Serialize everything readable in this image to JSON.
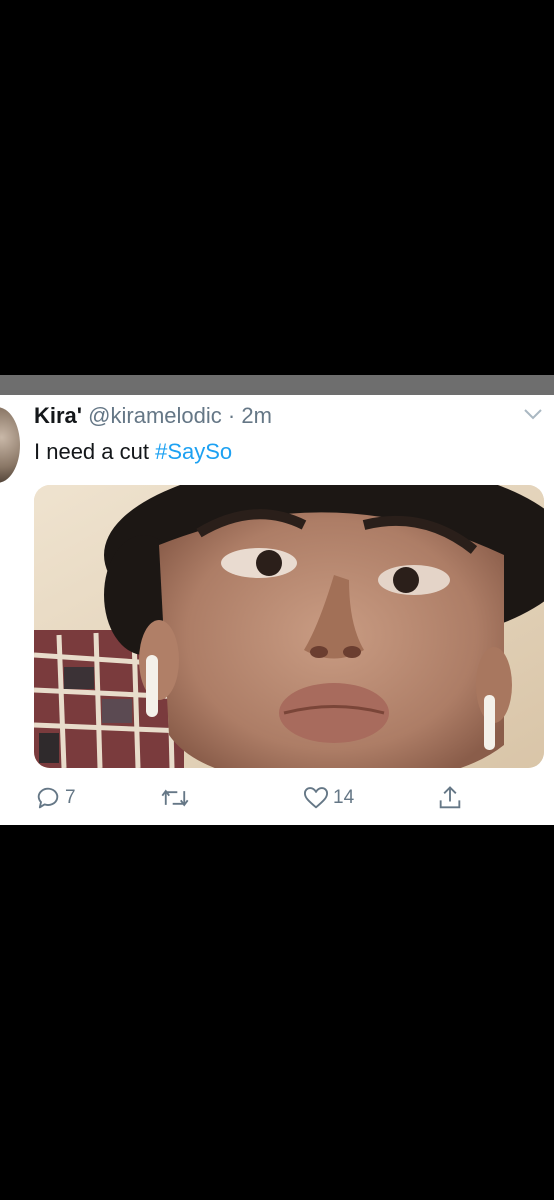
{
  "tweet": {
    "display_name": "Kira'",
    "handle": "@kiramelodic",
    "separator": "·",
    "timestamp": "2m",
    "text": "I need a cut ",
    "hashtag": "#SaySo",
    "menu_icon": "chevron-down-icon",
    "media_icon": "photo"
  },
  "actions": {
    "reply": {
      "icon": "reply-icon",
      "count": "7"
    },
    "retweet": {
      "icon": "retweet-icon",
      "count": ""
    },
    "like": {
      "icon": "heart-icon",
      "count": "14"
    },
    "share": {
      "icon": "share-icon",
      "count": ""
    }
  },
  "colors": {
    "background": "#000000",
    "card": "#ffffff",
    "text": "#14171a",
    "secondary": "#657786",
    "link": "#1da1f2",
    "divider_bar": "#6e6e6e"
  }
}
